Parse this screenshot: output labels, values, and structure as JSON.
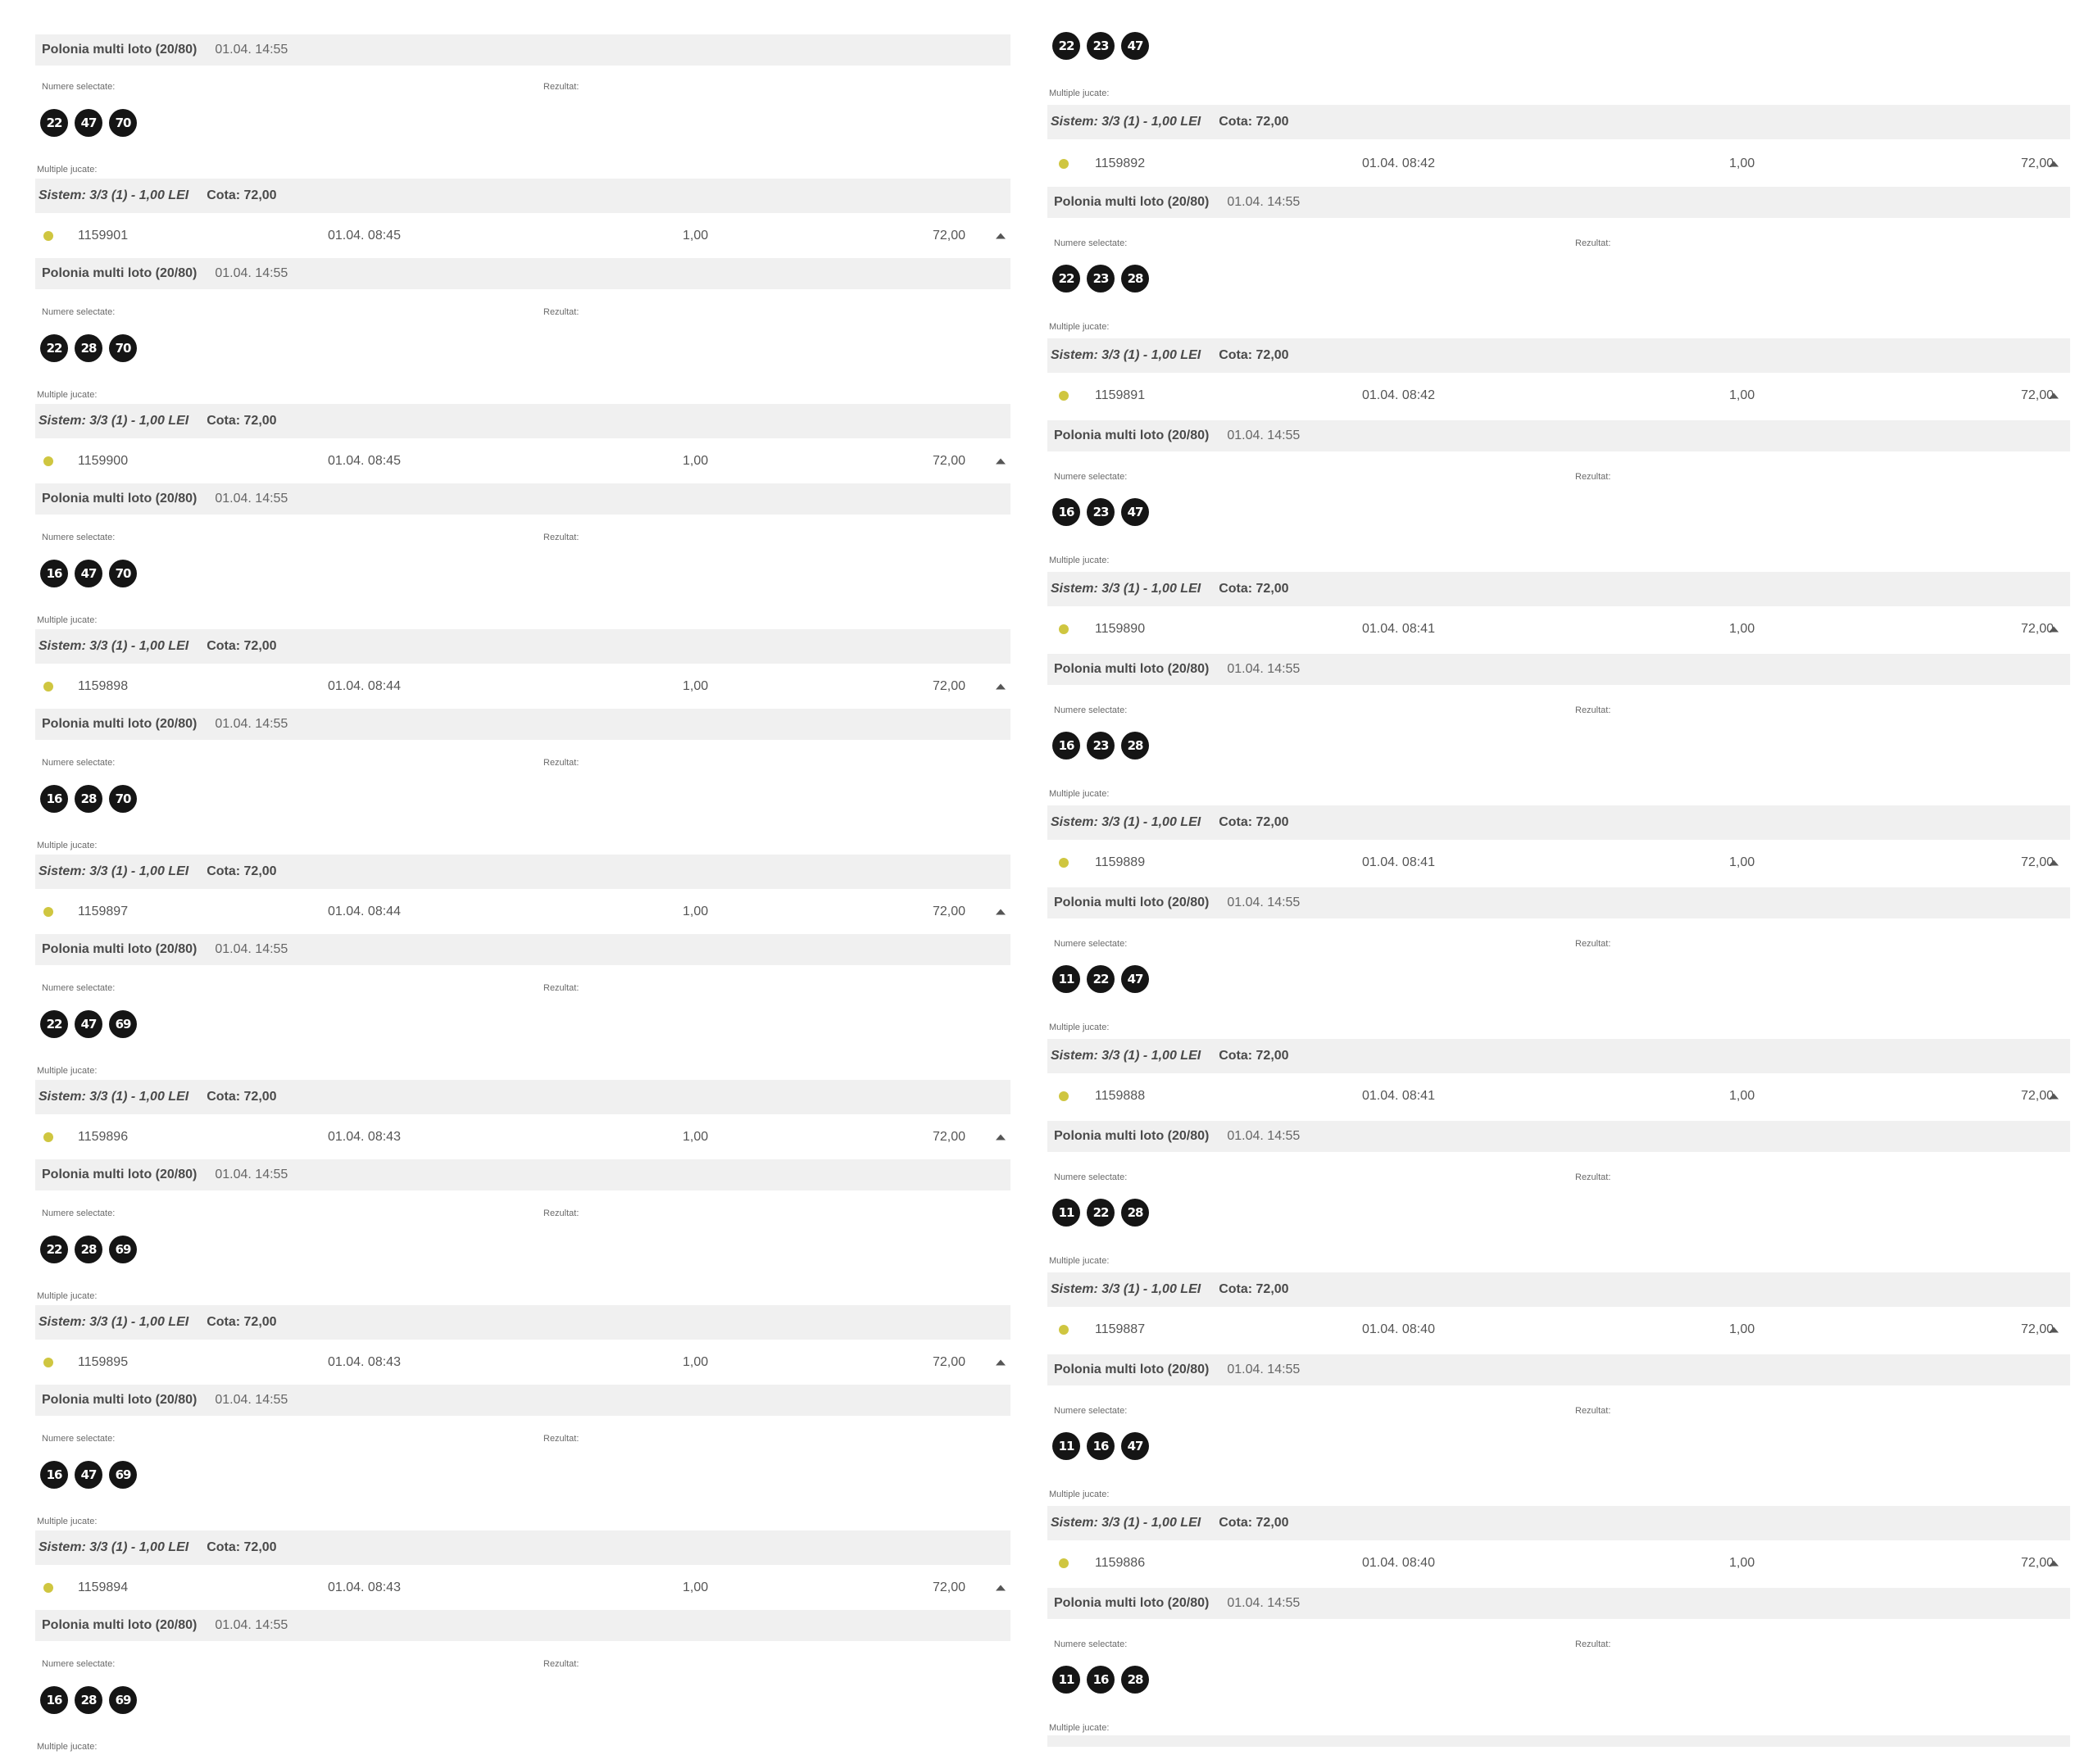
{
  "labels": {
    "game_name": "Polonia multi loto (20/80)",
    "draw_date": "01.04. 14:55",
    "numere_selectate": "Numere selectate:",
    "rezultat": "Rezultat:",
    "multiple_jucate": "Multiple jucate:",
    "sistem": "Sistem: 3/3 (1) - 1,00 LEI",
    "cota": "Cota: 72,00",
    "stake": "1,00",
    "winnings": "72,00"
  },
  "left_column": {
    "tickets": [
      {
        "balls": [
          "22",
          "47",
          "70"
        ],
        "id": "1159901",
        "time": "01.04. 08:45"
      },
      {
        "balls": [
          "22",
          "28",
          "70"
        ],
        "id": "1159900",
        "time": "01.04. 08:45"
      },
      {
        "balls": [
          "16",
          "47",
          "70"
        ],
        "id": "1159898",
        "time": "01.04. 08:44"
      },
      {
        "balls": [
          "16",
          "28",
          "70"
        ],
        "id": "1159897",
        "time": "01.04. 08:44"
      },
      {
        "balls": [
          "22",
          "47",
          "69"
        ],
        "id": "1159896",
        "time": "01.04. 08:43"
      },
      {
        "balls": [
          "22",
          "28",
          "69"
        ],
        "id": "1159895",
        "time": "01.04. 08:43"
      },
      {
        "balls": [
          "16",
          "47",
          "69"
        ],
        "id": "1159894",
        "time": "01.04. 08:43"
      }
    ],
    "last_balls": [
      "16",
      "28",
      "69"
    ]
  },
  "right_column": {
    "top_balls": [
      "22",
      "23",
      "47"
    ],
    "first_ticket": {
      "id": "1159892",
      "time": "01.04. 08:42"
    },
    "tickets": [
      {
        "balls": [
          "22",
          "23",
          "28"
        ],
        "id": "1159891",
        "time": "01.04. 08:42"
      },
      {
        "balls": [
          "16",
          "23",
          "47"
        ],
        "id": "1159890",
        "time": "01.04. 08:41"
      },
      {
        "balls": [
          "16",
          "23",
          "28"
        ],
        "id": "1159889",
        "time": "01.04. 08:41"
      },
      {
        "balls": [
          "11",
          "22",
          "47"
        ],
        "id": "1159888",
        "time": "01.04. 08:41"
      },
      {
        "balls": [
          "11",
          "22",
          "28"
        ],
        "id": "1159887",
        "time": "01.04. 08:40"
      },
      {
        "balls": [
          "11",
          "16",
          "47"
        ],
        "id": "1159886",
        "time": "01.04. 08:40"
      }
    ],
    "last_balls": [
      "11",
      "16",
      "28"
    ]
  },
  "colors": {
    "bar_bg": "#f0f0f0",
    "ball_bg": "#151515",
    "status_dot": "#cfc640"
  }
}
